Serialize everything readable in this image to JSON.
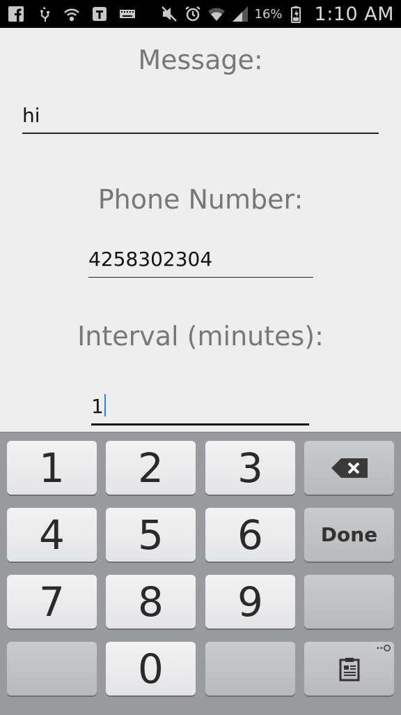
{
  "status_bar": {
    "icons_left": [
      "facebook-icon",
      "usb-icon",
      "wifi-hotspot-icon",
      "tmobile-icon",
      "keyboard-icon"
    ],
    "icons_right": [
      "mute-icon",
      "alarm-icon",
      "wifi-icon",
      "signal-icon",
      "battery-icon"
    ],
    "battery_percent": "16%",
    "time": "1:10 AM"
  },
  "form": {
    "message_label": "Message:",
    "message_value": "hi",
    "phone_label": "Phone Number:",
    "phone_value": "4258302304",
    "interval_label": "Interval (minutes):",
    "interval_value": "1"
  },
  "keyboard": {
    "keys": {
      "k1": "1",
      "k2": "2",
      "k3": "3",
      "k4": "4",
      "k5": "5",
      "k6": "6",
      "k7": "7",
      "k8": "8",
      "k9": "9",
      "k0": "0",
      "done": "Done"
    },
    "icons": [
      "backspace-icon",
      "clipboard-icon"
    ]
  }
}
